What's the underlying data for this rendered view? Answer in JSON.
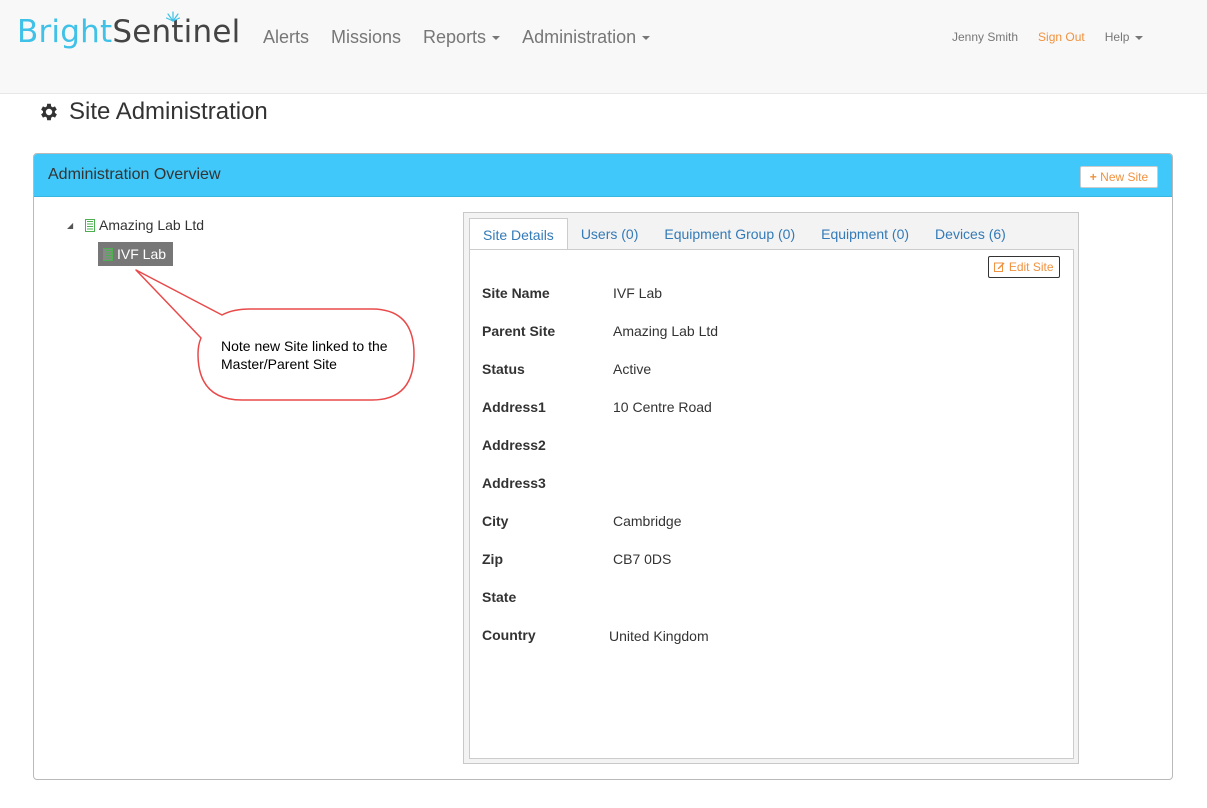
{
  "brand": {
    "part1": "Bright",
    "part2": "Sentinel"
  },
  "nav": {
    "alerts": "Alerts",
    "missions": "Missions",
    "reports": "Reports",
    "administration": "Administration"
  },
  "user_nav": {
    "user": "Jenny Smith",
    "signout": "Sign Out",
    "help": "Help"
  },
  "page": {
    "title": "Site Administration"
  },
  "panel": {
    "title": "Administration Overview",
    "new_site": "New Site"
  },
  "tree": {
    "root": "Amazing Lab Ltd",
    "child": "IVF Lab"
  },
  "callout": {
    "text": "Note new Site linked to the Master/Parent Site"
  },
  "tabs": [
    "Site Details",
    "Users (0)",
    "Equipment Group (0)",
    "Equipment (0)",
    "Devices (6)"
  ],
  "edit_site": "Edit Site",
  "details": [
    {
      "label": "Site Name",
      "value": "IVF Lab"
    },
    {
      "label": "Parent Site",
      "value": "Amazing Lab Ltd"
    },
    {
      "label": "Status",
      "value": "Active"
    },
    {
      "label": "Address1",
      "value": "10 Centre Road"
    },
    {
      "label": "Address2",
      "value": ""
    },
    {
      "label": "Address3",
      "value": ""
    },
    {
      "label": "City",
      "value": "Cambridge"
    },
    {
      "label": "Zip",
      "value": "CB7 0DS"
    },
    {
      "label": "State",
      "value": ""
    },
    {
      "label": "Country",
      "value": "United Kingdom"
    }
  ],
  "colors": {
    "accent": "#3fc8f9",
    "brand_blue": "#3fc1e8",
    "orange": "#f0923f",
    "link": "#337ab7",
    "callout_red": "#e84a4a"
  },
  "icons": {
    "title": "cog-icon",
    "tree_root": "building-icon",
    "tree_child": "building-icon",
    "new_site": "plus-icon",
    "edit_site": "edit-icon"
  }
}
